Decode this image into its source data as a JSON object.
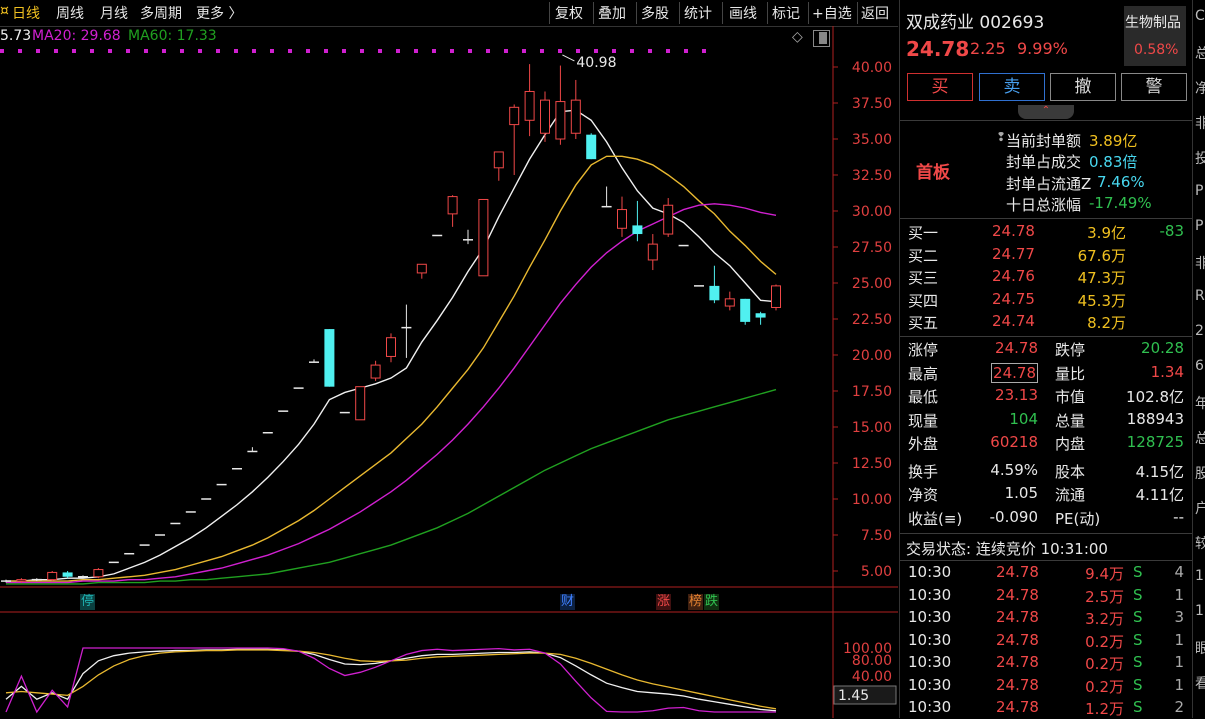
{
  "toolbar": {
    "left_items": [
      "日线",
      "周线",
      "月线",
      "多周期",
      "更多 〉"
    ],
    "right_items": [
      "复权",
      "叠加",
      "多股",
      "统计",
      "画线",
      "标记",
      "+自选",
      "返回"
    ]
  },
  "ma_legend": {
    "ma5": "5.73",
    "ma20": "MA20: 29.68",
    "ma60": "MA60: 17.33"
  },
  "chart_data": {
    "type": "candlestick",
    "y_ticks": [
      "40.00",
      "37.50",
      "35.00",
      "32.50",
      "30.00",
      "27.50",
      "25.00",
      "22.50",
      "20.00",
      "17.50",
      "15.00",
      "12.50",
      "10.00",
      "7.50",
      "5.00"
    ],
    "ylim": [
      3.0,
      42.0
    ],
    "high_annotation": "40.98",
    "candles": [
      {
        "o": 4.3,
        "c": 4.3,
        "h": 4.4,
        "l": 4.2,
        "col": "line"
      },
      {
        "o": 4.3,
        "c": 4.4,
        "h": 4.5,
        "l": 4.2,
        "col": "red"
      },
      {
        "o": 4.4,
        "c": 4.4,
        "h": 4.5,
        "l": 4.3,
        "col": "line"
      },
      {
        "o": 4.4,
        "c": 4.9,
        "h": 5.0,
        "l": 4.3,
        "col": "red"
      },
      {
        "o": 4.9,
        "c": 4.6,
        "h": 5.0,
        "l": 4.5,
        "col": "cyan"
      },
      {
        "o": 4.6,
        "c": 4.6,
        "h": 4.7,
        "l": 4.5,
        "col": "line"
      },
      {
        "o": 4.6,
        "c": 5.1,
        "h": 5.2,
        "l": 4.5,
        "col": "red"
      },
      {
        "o": 5.6,
        "c": 5.6,
        "h": 5.6,
        "l": 5.6,
        "col": "line"
      },
      {
        "o": 6.2,
        "c": 6.2,
        "h": 6.2,
        "l": 6.2,
        "col": "line"
      },
      {
        "o": 6.8,
        "c": 6.8,
        "h": 6.8,
        "l": 6.8,
        "col": "line"
      },
      {
        "o": 7.5,
        "c": 7.5,
        "h": 7.5,
        "l": 7.5,
        "col": "line"
      },
      {
        "o": 8.3,
        "c": 8.3,
        "h": 8.3,
        "l": 8.3,
        "col": "line"
      },
      {
        "o": 9.1,
        "c": 9.1,
        "h": 9.1,
        "l": 9.1,
        "col": "line"
      },
      {
        "o": 10.0,
        "c": 10.0,
        "h": 10.0,
        "l": 10.0,
        "col": "line"
      },
      {
        "o": 11.0,
        "c": 11.0,
        "h": 11.0,
        "l": 11.0,
        "col": "line"
      },
      {
        "o": 12.1,
        "c": 12.1,
        "h": 12.1,
        "l": 12.1,
        "col": "line"
      },
      {
        "o": 13.3,
        "c": 13.3,
        "h": 13.6,
        "l": 13.3,
        "col": "line"
      },
      {
        "o": 14.6,
        "c": 14.6,
        "h": 14.6,
        "l": 14.6,
        "col": "line"
      },
      {
        "o": 16.1,
        "c": 16.1,
        "h": 16.1,
        "l": 16.1,
        "col": "line"
      },
      {
        "o": 17.7,
        "c": 17.7,
        "h": 17.7,
        "l": 17.7,
        "col": "line"
      },
      {
        "o": 19.5,
        "c": 19.5,
        "h": 19.7,
        "l": 19.5,
        "col": "line"
      },
      {
        "o": 21.8,
        "c": 17.8,
        "h": 21.8,
        "l": 17.8,
        "col": "cyan"
      },
      {
        "o": 16.0,
        "c": 16.0,
        "h": 16.0,
        "l": 16.0,
        "col": "line"
      },
      {
        "o": 15.5,
        "c": 17.8,
        "h": 17.8,
        "l": 15.5,
        "col": "red"
      },
      {
        "o": 18.4,
        "c": 19.3,
        "h": 19.6,
        "l": 18.2,
        "col": "red"
      },
      {
        "o": 19.9,
        "c": 21.2,
        "h": 21.5,
        "l": 19.5,
        "col": "red"
      },
      {
        "o": 21.9,
        "c": 21.9,
        "h": 23.5,
        "l": 19.8,
        "col": "line"
      },
      {
        "o": 25.7,
        "c": 26.3,
        "h": 26.3,
        "l": 25.3,
        "col": "red"
      },
      {
        "o": 28.3,
        "c": 28.3,
        "h": 28.3,
        "l": 28.3,
        "col": "line"
      },
      {
        "o": 29.8,
        "c": 31.0,
        "h": 31.1,
        "l": 28.9,
        "col": "red"
      },
      {
        "o": 28.0,
        "c": 28.0,
        "h": 28.7,
        "l": 27.7,
        "col": "line"
      },
      {
        "o": 25.5,
        "c": 30.8,
        "h": 30.8,
        "l": 25.5,
        "col": "red"
      },
      {
        "o": 33.0,
        "c": 34.1,
        "h": 34.1,
        "l": 32.1,
        "col": "red"
      },
      {
        "o": 36.0,
        "c": 37.2,
        "h": 37.4,
        "l": 32.5,
        "col": "red"
      },
      {
        "o": 36.3,
        "c": 38.3,
        "h": 40.2,
        "l": 35.2,
        "col": "red"
      },
      {
        "o": 35.4,
        "c": 37.7,
        "h": 38.3,
        "l": 34.8,
        "col": "red"
      },
      {
        "o": 35.0,
        "c": 37.6,
        "h": 40.1,
        "l": 34.6,
        "col": "red"
      },
      {
        "o": 35.4,
        "c": 37.7,
        "h": 39.1,
        "l": 35.0,
        "col": "red"
      },
      {
        "o": 35.3,
        "c": 33.6,
        "h": 35.4,
        "l": 33.6,
        "col": "cyan"
      },
      {
        "o": 30.3,
        "c": 30.3,
        "h": 31.7,
        "l": 30.3,
        "col": "line"
      },
      {
        "o": 28.8,
        "c": 30.1,
        "h": 31.0,
        "l": 28.2,
        "col": "red"
      },
      {
        "o": 29.0,
        "c": 28.4,
        "h": 30.7,
        "l": 27.9,
        "col": "cyan"
      },
      {
        "o": 26.6,
        "c": 27.7,
        "h": 28.4,
        "l": 25.9,
        "col": "red"
      },
      {
        "o": 28.4,
        "c": 30.4,
        "h": 30.9,
        "l": 28.2,
        "col": "red"
      },
      {
        "o": 27.6,
        "c": 27.6,
        "h": 27.6,
        "l": 27.6,
        "col": "line"
      },
      {
        "o": 24.8,
        "c": 24.8,
        "h": 24.8,
        "l": 24.8,
        "col": "line"
      },
      {
        "o": 24.8,
        "c": 23.8,
        "h": 26.2,
        "l": 23.6,
        "col": "cyan"
      },
      {
        "o": 23.4,
        "c": 23.9,
        "h": 24.4,
        "l": 23.1,
        "col": "red"
      },
      {
        "o": 23.9,
        "c": 22.3,
        "h": 23.9,
        "l": 22.1,
        "col": "cyan"
      },
      {
        "o": 22.9,
        "c": 22.6,
        "h": 23.0,
        "l": 22.1,
        "col": "cyan"
      },
      {
        "o": 23.3,
        "c": 24.8,
        "h": 24.9,
        "l": 23.1,
        "col": "red"
      }
    ],
    "ma_series": [
      {
        "name": "MA5",
        "color": "#f0f0f0",
        "values": [
          4.3,
          4.3,
          4.4,
          4.4,
          4.5,
          4.5,
          4.6,
          4.8,
          5.2,
          5.6,
          6.1,
          6.7,
          7.3,
          8.0,
          8.8,
          9.6,
          10.5,
          11.5,
          12.6,
          13.8,
          15.2,
          16.9,
          17.4,
          17.7,
          18.0,
          18.4,
          19.1,
          20.9,
          22.4,
          24.0,
          25.8,
          27.4,
          29.6,
          31.6,
          33.6,
          35.3,
          36.9,
          37.0,
          36.3,
          34.8,
          33.0,
          31.4,
          30.2,
          29.8,
          29.2,
          28.2,
          27.1,
          26.2,
          25.0,
          23.8,
          23.7
        ]
      },
      {
        "name": "MA20",
        "color": "#e8b830",
        "values": [
          4.3,
          4.3,
          4.3,
          4.3,
          4.3,
          4.4,
          4.4,
          4.5,
          4.6,
          4.7,
          4.9,
          5.1,
          5.4,
          5.7,
          6.0,
          6.4,
          6.8,
          7.3,
          7.9,
          8.5,
          9.2,
          10.0,
          10.8,
          11.6,
          12.4,
          13.2,
          14.2,
          15.2,
          16.4,
          17.7,
          19.0,
          20.5,
          22.3,
          24.1,
          26.1,
          28.0,
          30.0,
          31.8,
          33.2,
          33.8,
          33.8,
          33.6,
          33.2,
          32.5,
          31.7,
          30.7,
          29.8,
          28.6,
          27.6,
          26.5,
          25.6
        ]
      },
      {
        "name": "MA60",
        "color": "#d020d0",
        "values": [
          4.2,
          4.2,
          4.2,
          4.2,
          4.2,
          4.3,
          4.3,
          4.3,
          4.4,
          4.4,
          4.5,
          4.6,
          4.8,
          5.0,
          5.2,
          5.5,
          5.8,
          6.1,
          6.5,
          6.9,
          7.4,
          7.9,
          8.5,
          9.1,
          9.8,
          10.5,
          11.3,
          12.2,
          13.1,
          14.1,
          15.2,
          16.4,
          17.7,
          19.1,
          20.6,
          22.1,
          23.6,
          24.9,
          26.1,
          27.1,
          27.9,
          28.6,
          29.1,
          29.6,
          30.1,
          30.4,
          30.5,
          30.4,
          30.2,
          29.9,
          29.7
        ]
      },
      {
        "name": "MA120",
        "color": "#20a020",
        "values": [
          4.1,
          4.1,
          4.1,
          4.1,
          4.1,
          4.1,
          4.2,
          4.2,
          4.2,
          4.2,
          4.3,
          4.3,
          4.4,
          4.4,
          4.5,
          4.6,
          4.7,
          4.8,
          5.0,
          5.2,
          5.4,
          5.6,
          5.9,
          6.2,
          6.5,
          6.8,
          7.2,
          7.6,
          8.0,
          8.5,
          9.0,
          9.6,
          10.2,
          10.8,
          11.4,
          12.0,
          12.5,
          13.0,
          13.5,
          13.9,
          14.3,
          14.7,
          15.1,
          15.5,
          15.8,
          16.1,
          16.4,
          16.7,
          17.0,
          17.3,
          17.6
        ]
      }
    ],
    "lower_indicator": {
      "y_ticks": [
        "100.00",
        "80.00",
        "40.00"
      ],
      "current": "1.45",
      "series": [
        {
          "name": "K",
          "color": "#f0f0f0",
          "values": [
            20,
            40,
            20,
            30,
            20,
            60,
            80,
            88,
            92,
            94,
            95,
            96,
            96,
            97,
            97,
            98,
            98,
            98,
            97,
            95,
            90,
            82,
            75,
            74,
            76,
            80,
            84,
            88,
            90,
            90,
            91,
            92,
            93,
            93,
            94,
            92,
            85,
            72,
            58,
            45,
            38,
            32,
            30,
            28,
            25,
            20,
            16,
            12,
            8,
            4,
            2
          ]
        },
        {
          "name": "D",
          "color": "#e8b830",
          "values": [
            30,
            32,
            30,
            28,
            26,
            40,
            58,
            72,
            82,
            88,
            92,
            94,
            95,
            96,
            96,
            97,
            97,
            97,
            96,
            95,
            93,
            89,
            84,
            80,
            79,
            80,
            81,
            84,
            86,
            87,
            88,
            89,
            90,
            91,
            92,
            92,
            90,
            84,
            76,
            67,
            58,
            50,
            44,
            39,
            34,
            29,
            24,
            19,
            14,
            9,
            5
          ]
        },
        {
          "name": "J",
          "color": "#d020d0",
          "values": [
            0,
            56,
            0,
            34,
            8,
            100,
            100,
            100,
            100,
            100,
            100,
            100,
            100,
            100,
            100,
            100,
            100,
            100,
            99,
            95,
            84,
            68,
            57,
            62,
            70,
            80,
            90,
            96,
            98,
            96,
            97,
            98,
            99,
            97,
            98,
            92,
            75,
            48,
            22,
            1,
            0,
            0,
            2,
            6,
            7,
            2,
            0,
            0,
            0,
            0,
            0
          ]
        }
      ]
    },
    "event_marks": [
      {
        "label": "停",
        "color": "#1fb0b0",
        "bg": "#0b4040"
      },
      {
        "label": "财",
        "color": "#4080ff",
        "bg": "#0c2040"
      },
      {
        "label": "涨",
        "color": "#f04848",
        "bg": "#401010"
      },
      {
        "label": "榜",
        "color": "#e08030",
        "bg": "#402010"
      },
      {
        "label": "跌",
        "color": "#30c050",
        "bg": "#103010"
      }
    ]
  },
  "stock": {
    "name_code": "双成药业 002693",
    "price": "24.78",
    "change": "2.25",
    "change_pct": "9.99%",
    "sector": "生物制品",
    "sector_pct": "0.58%"
  },
  "actions": [
    "买",
    "卖",
    "撤",
    "警"
  ],
  "limit_board": {
    "tag": "首板",
    "rows": [
      {
        "label": "当前封单额",
        "value": "3.89亿",
        "color": "yellow"
      },
      {
        "label": "封单占成交",
        "value": "0.83倍",
        "color": "cyan"
      },
      {
        "label": "封单占流通Z",
        "value": "7.46%",
        "color": "cyan"
      },
      {
        "label": "十日总涨幅",
        "value": "-17.49%",
        "color": "green"
      }
    ]
  },
  "order_book": [
    {
      "label": "买一",
      "price": "24.78",
      "vol": "3.9亿",
      "delta": "-83"
    },
    {
      "label": "买二",
      "price": "24.77",
      "vol": "67.6万",
      "delta": ""
    },
    {
      "label": "买三",
      "price": "24.76",
      "vol": "47.3万",
      "delta": ""
    },
    {
      "label": "买四",
      "price": "24.75",
      "vol": "45.3万",
      "delta": ""
    },
    {
      "label": "买五",
      "price": "24.74",
      "vol": "8.2万",
      "delta": ""
    }
  ],
  "stats": [
    {
      "l1": "涨停",
      "v1": "24.78",
      "c1": "red",
      "l2": "跌停",
      "v2": "20.28",
      "c2": "green"
    },
    {
      "l1": "最高",
      "v1": "24.78",
      "c1": "red",
      "l2": "量比",
      "v2": "1.34",
      "c2": "red"
    },
    {
      "l1": "最低",
      "v1": "23.13",
      "c1": "red",
      "l2": "市值",
      "v2": "102.8亿",
      "c2": "white"
    },
    {
      "l1": "现量",
      "v1": "104",
      "c1": "green",
      "l2": "总量",
      "v2": "188943",
      "c2": "white"
    },
    {
      "l1": "外盘",
      "v1": "60218",
      "c1": "red",
      "l2": "内盘",
      "v2": "128725",
      "c2": "green"
    },
    {
      "l1": "换手",
      "v1": "4.59%",
      "c1": "white",
      "l2": "股本",
      "v2": "4.15亿",
      "c2": "white"
    },
    {
      "l1": "净资",
      "v1": "1.05",
      "c1": "white",
      "l2": "流通",
      "v2": "4.11亿",
      "c2": "white"
    },
    {
      "l1": "收益(≡)",
      "v1": "-0.090",
      "c1": "white",
      "l2": "PE(动)",
      "v2": "--",
      "c2": "white"
    }
  ],
  "trade_status": "交易状态: 连续竞价 10:31:00",
  "ticks": [
    {
      "t": "10:30",
      "p": "24.78",
      "v": "9.4万",
      "s": "S",
      "n": "4"
    },
    {
      "t": "10:30",
      "p": "24.78",
      "v": "2.5万",
      "s": "S",
      "n": "1"
    },
    {
      "t": "10:30",
      "p": "24.78",
      "v": "3.2万",
      "s": "S",
      "n": "3"
    },
    {
      "t": "10:30",
      "p": "24.78",
      "v": "0.2万",
      "s": "S",
      "n": "1"
    },
    {
      "t": "10:30",
      "p": "24.78",
      "v": "0.2万",
      "s": "S",
      "n": "1"
    },
    {
      "t": "10:30",
      "p": "24.78",
      "v": "0.2万",
      "s": "S",
      "n": "1"
    },
    {
      "t": "10:30",
      "p": "24.78",
      "v": "1.2万",
      "s": "S",
      "n": "2"
    }
  ],
  "edge_chars": [
    "C",
    "总",
    "净",
    "非",
    "投",
    "P",
    "P",
    "非",
    "R",
    "2",
    "6",
    "年",
    "总",
    "股",
    "户",
    "较",
    "1",
    "1",
    "眼",
    "看"
  ]
}
